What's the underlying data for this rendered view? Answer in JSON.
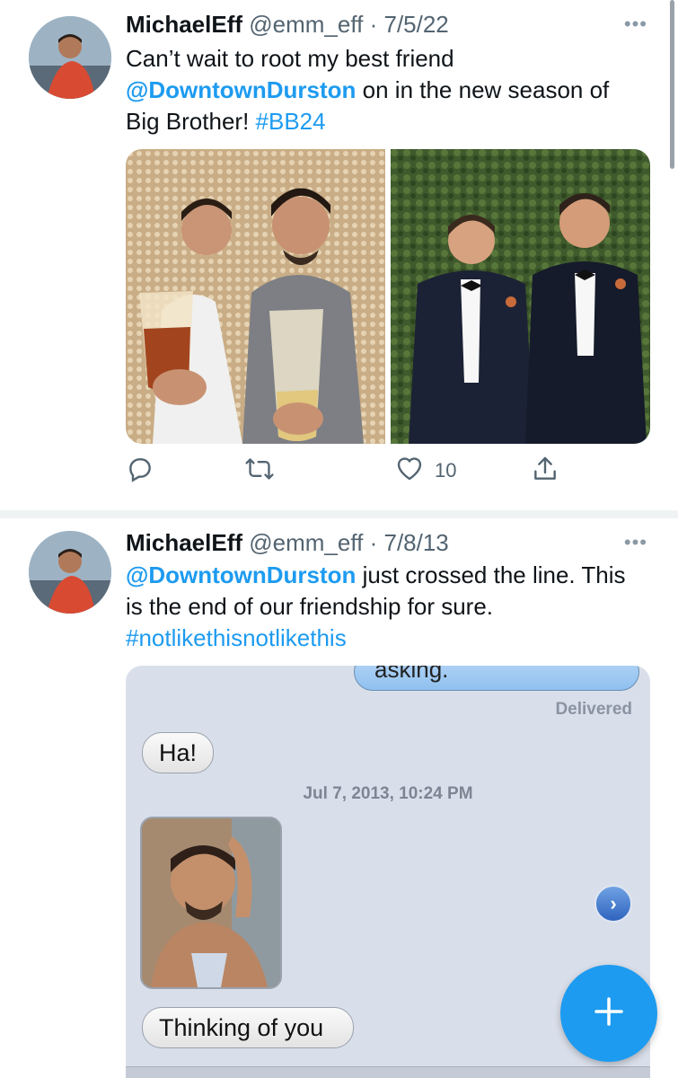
{
  "tweets": [
    {
      "author_name": "MichaelEff",
      "handle": "@emm_eff",
      "separator": "·",
      "date": "7/5/22",
      "more": "•••",
      "text_before": "Can’t wait to root my best friend ",
      "mention": "@DowntownDurston",
      "text_after": " on in the new season of Big Brother! ",
      "hashtag": "#BB24",
      "like_count": "10"
    },
    {
      "author_name": "MichaelEff",
      "handle": "@emm_eff",
      "separator": "·",
      "date": "7/8/13",
      "more": "•••",
      "mention": "@DowntownDurston",
      "text_after": " just crossed the line. This is the end of our friendship for sure. ",
      "hashtag": "#notlikethisnotlikethis",
      "sms": {
        "outgoing_text": "asking.",
        "delivered": "Delivered",
        "incoming_1": "Ha!",
        "timestamp": "Jul 7, 2013, 10:24 PM",
        "incoming_2": "Thinking of you"
      }
    }
  ],
  "icons": {
    "reply": "reply-icon",
    "retweet": "retweet-icon",
    "like": "heart-icon",
    "share": "share-icon",
    "compose": "plus-icon"
  },
  "colors": {
    "accent": "#1d9bf0",
    "muted": "#536471",
    "text": "#0f1419"
  }
}
